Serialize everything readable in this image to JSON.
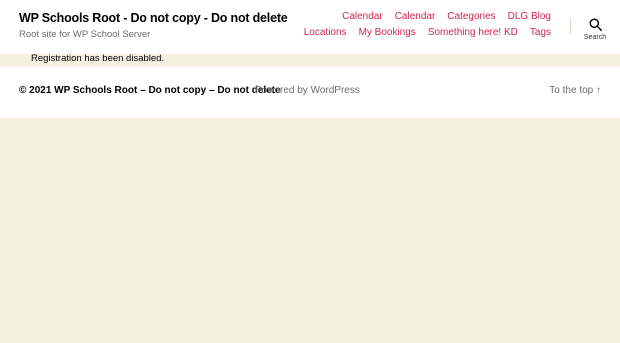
{
  "header": {
    "site_title": "WP Schools Root - Do not copy - Do not delete",
    "site_description": "Root site for WP School Server",
    "nav": [
      {
        "label": "Calendar"
      },
      {
        "label": "Calendar"
      },
      {
        "label": "Categories"
      },
      {
        "label": "DLG Blog"
      },
      {
        "label": "Locations"
      },
      {
        "label": "My Bookings"
      },
      {
        "label": "Something here! KD"
      },
      {
        "label": "Tags"
      }
    ],
    "search_label": "Search",
    "search_icon": "search-icon"
  },
  "main": {
    "notice": "Registration has been disabled."
  },
  "footer": {
    "copyright": "© 2021 WP Schools Root – Do not copy – Do not delete",
    "powered_by": "Powered by WordPress",
    "to_top": "To the top ↑"
  },
  "colors": {
    "accent": "#cd2653",
    "background": "#f5efe0",
    "header_bg": "#ffffff",
    "muted_text": "#6d6d6d"
  }
}
